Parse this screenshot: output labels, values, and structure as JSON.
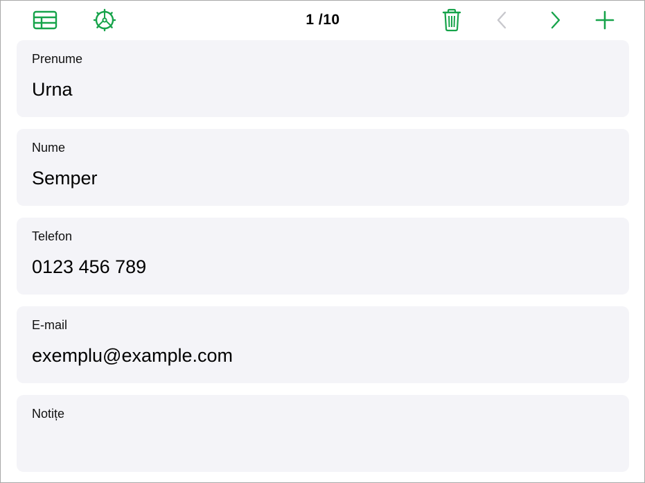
{
  "colors": {
    "accent": "#16a34a",
    "disabled": "#c7c7cc",
    "field_background": "#f4f4f8"
  },
  "toolbar": {
    "table_view_icon": "table-grid-icon",
    "settings_icon": "gear-icon",
    "record_counter": "1 /10",
    "delete_icon": "trash-icon",
    "previous_icon": "chevron-left-icon",
    "next_icon": "chevron-right-icon",
    "add_icon": "plus-icon"
  },
  "fields": [
    {
      "label": "Prenume",
      "value": "Urna"
    },
    {
      "label": "Nume",
      "value": "Semper"
    },
    {
      "label": "Telefon",
      "value": "0123 456 789"
    },
    {
      "label": "E-mail",
      "value": "exemplu@example.com"
    },
    {
      "label": "Notițe",
      "value": ""
    }
  ]
}
